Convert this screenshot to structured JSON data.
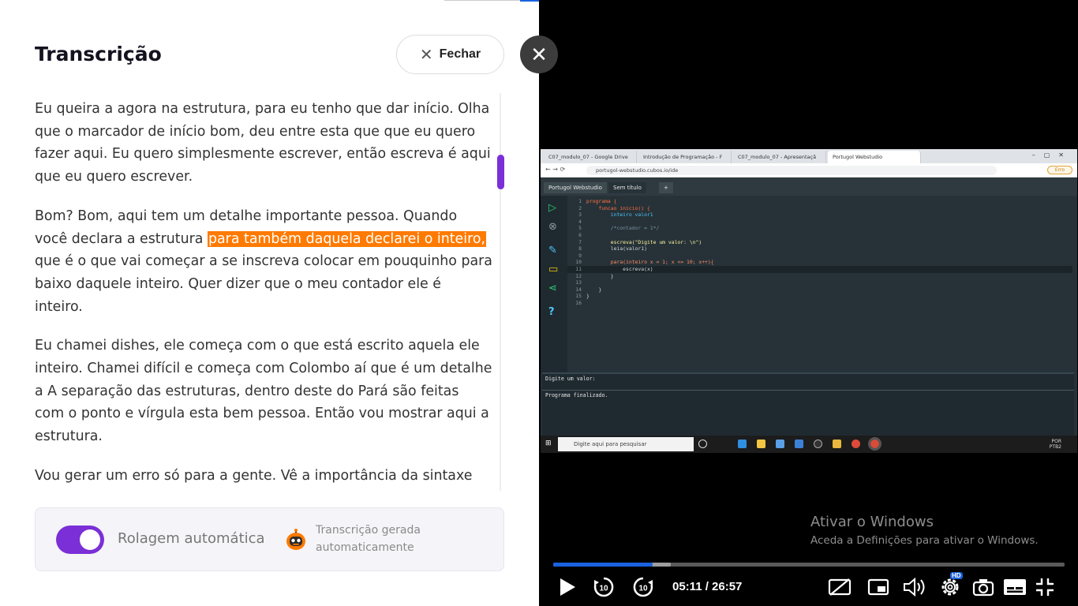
{
  "panel": {
    "title": "Transcrição",
    "close_label": "Fechar",
    "paragraphs": [
      {
        "before": "Eu queira a agora na estrutura, para eu tenho que dar início. Olha que o marcador de início bom, deu entre esta que que eu quero fazer aqui. Eu quero simplesmente escrever, então escreva é aqui que eu quero escrever.",
        "highlight": "",
        "after": ""
      },
      {
        "before": "Bom? Bom, aqui tem um detalhe importante pessoa. Quando você declara a estrutura ",
        "highlight": "para também daquela declarei o inteiro,",
        "after": " que é o que vai começar a se inscreva colocar em pouquinho para baixo daquele inteiro. Quer dizer que o meu contador ele é inteiro."
      },
      {
        "before": "Eu chamei dishes, ele começa com o que está escrito aquela ele inteiro. Chamei difícil e começa com Colombo aí que é um detalhe a A separação das estruturas, dentro deste do Pará são feitas com o ponto e vírgula esta bem pessoa. Então vou mostrar aqui a estrutura.",
        "highlight": "",
        "after": ""
      },
      {
        "before": "Vou gerar um erro só para a gente. Vê a importância da sintaxe",
        "highlight": "",
        "after": ""
      }
    ],
    "autoscroll_label": "Rolagem automática",
    "autoscroll_on": true,
    "generated_label": "Transcrição gerada automaticamente",
    "accent_color": "#7b2fd6",
    "highlight_color": "#ff7a00"
  },
  "video": {
    "browser_tabs": [
      "C07_modulo_07 - Google Drive",
      "Introdução de Programação - F",
      "C07_modulo_07 - Apresentaçã",
      "Portugol Webstudio"
    ],
    "url": "portugol-webstudio.cubos.io/ide",
    "error_pill": "Erro",
    "ide_tabs": [
      "Portugol Webstudio",
      "Sem título",
      "+"
    ],
    "code_lines": [
      {
        "n": "1",
        "text": "programa {"
      },
      {
        "n": "2",
        "text": "    funcao inicio() {"
      },
      {
        "n": "3",
        "text": "        inteiro valor1"
      },
      {
        "n": "4",
        "text": ""
      },
      {
        "n": "5",
        "text": "        /*contador = 1*/"
      },
      {
        "n": "6",
        "text": ""
      },
      {
        "n": "7",
        "text": "        escreva(\"Digite um valor: \\n\")"
      },
      {
        "n": "8",
        "text": "        leia(valor1)"
      },
      {
        "n": "9",
        "text": ""
      },
      {
        "n": "10",
        "text": "        para(inteiro x = 1; x <= 10; x++){"
      },
      {
        "n": "11",
        "text": "            escreva(x)"
      },
      {
        "n": "12",
        "text": "        }"
      },
      {
        "n": "13",
        "text": ""
      },
      {
        "n": "14",
        "text": "    }"
      },
      {
        "n": "15",
        "text": "}"
      },
      {
        "n": "16",
        "text": ""
      }
    ],
    "console_lines": [
      "Digite um valor:",
      "Programa finalizado."
    ],
    "taskbar_search": "Digite aqui para pesquisar",
    "tray_lang": "POR",
    "tray_layout": "PTB2",
    "watermark_title": "Ativar o Windows",
    "watermark_sub": "Aceda a Definições para ativar o Windows.",
    "time_display": "05:11 / 26:57",
    "progress_played_fraction": 0.194,
    "progress_buffer_fraction": 0.23,
    "hd_badge": "HD"
  }
}
